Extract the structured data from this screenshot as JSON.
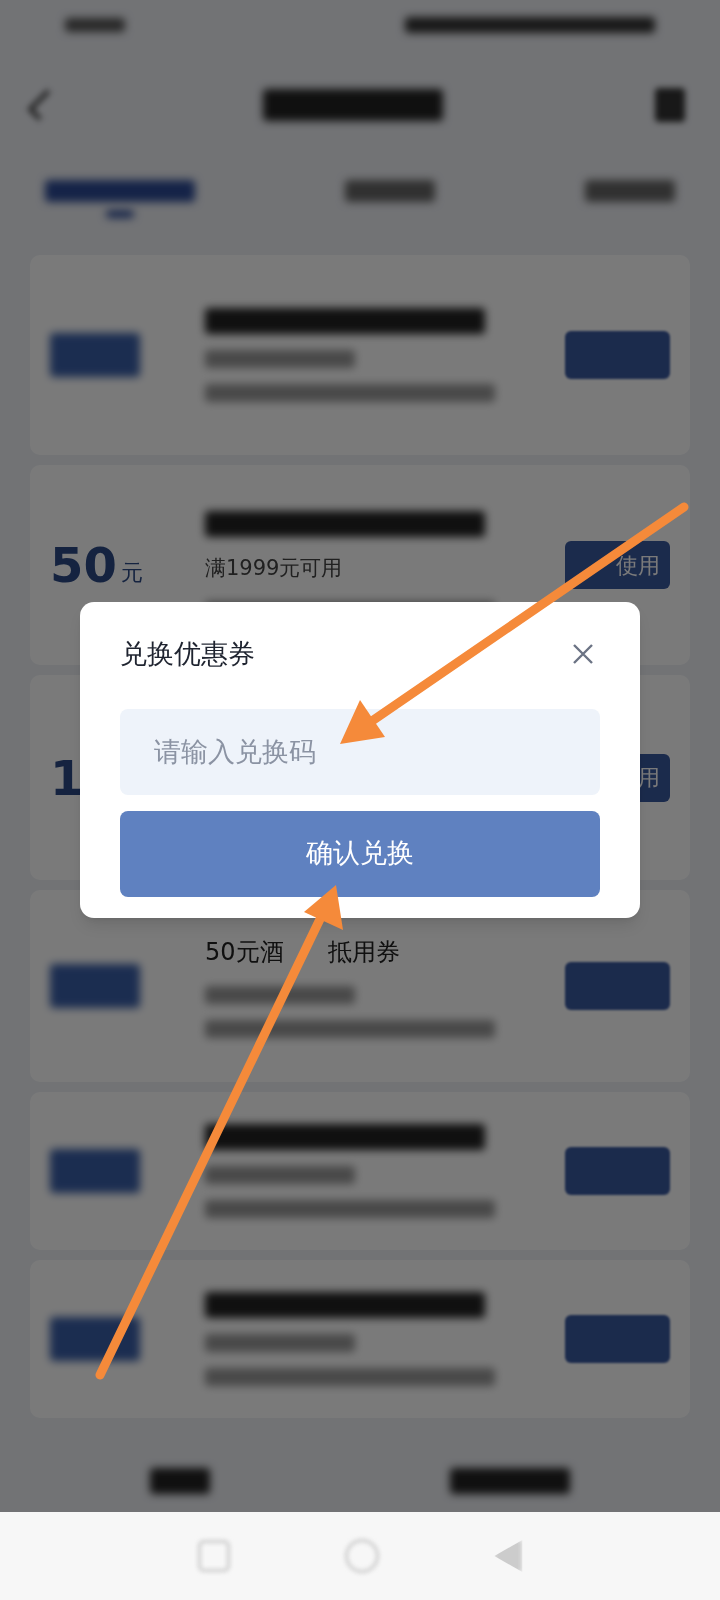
{
  "coupons": [
    {
      "kind": "hidden"
    },
    {
      "kind": "partial",
      "amount": "50",
      "unit": "元",
      "condition": "满1999元可用",
      "action": "使用"
    },
    {
      "kind": "partial",
      "amount": "1",
      "action": "用"
    },
    {
      "kind": "partial",
      "title_parts": [
        "50元酒",
        "抵用券"
      ]
    },
    {
      "kind": "hidden"
    },
    {
      "kind": "hidden"
    }
  ],
  "dialog": {
    "title": "兑换优惠券",
    "placeholder": "请输入兑换码",
    "button": "确认兑换"
  }
}
